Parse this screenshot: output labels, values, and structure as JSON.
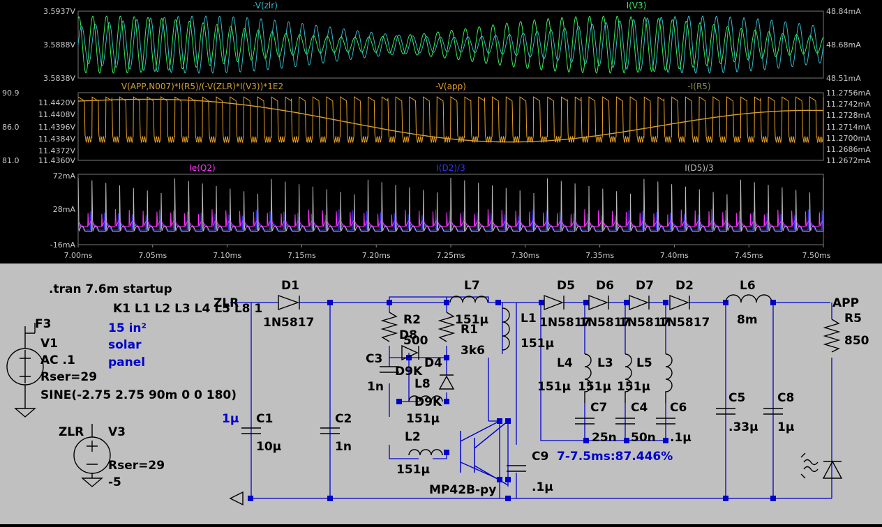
{
  "colors": {
    "zlr": "#33bbcc",
    "iv3": "#33ee55",
    "power": "#d4a030",
    "vapp": "#e8a020",
    "ir5": "#8a8a50",
    "ieq2": "#ff33ff",
    "id2": "#3333ff",
    "id5": "#bbbbbb",
    "wire": "#0000cc",
    "junction": "#0000cc",
    "blue_text": "#0000cc"
  },
  "chart_data": [
    {
      "type": "line",
      "series": [
        {
          "name": "-V(zlr)",
          "color": "#33bbcc",
          "axis": "left",
          "min": 3.5838,
          "max": 3.5937,
          "cycles": 54
        },
        {
          "name": "I(V3)",
          "color": "#33ee55",
          "axis": "right",
          "min": 48.51,
          "max": 48.84,
          "cycles": 54
        }
      ],
      "left_ticks": [
        "3.5937V",
        "3.5888V",
        "3.5838V"
      ],
      "right_ticks": [
        "48.84mA",
        "48.68mA",
        "48.51mA"
      ]
    },
    {
      "type": "line",
      "series": [
        {
          "name": "V(APP,N007)*I(R5)/(-V(ZLR)*I(V3))*1E2",
          "color": "#d4a030",
          "axis": "outer",
          "min": 81.0,
          "max": 90.9
        },
        {
          "name": "-V(app)",
          "color": "#e8a020",
          "axis": "left",
          "min": 11.436,
          "max": 11.442,
          "cycles": 54
        },
        {
          "name": "-I(R5)",
          "color": "#8a8a50",
          "axis": "right",
          "min": 11.2672,
          "max": 11.2756
        }
      ],
      "outer_ticks": [
        "90.9",
        "86.0",
        "81.0"
      ],
      "left_ticks": [
        "11.4420V",
        "11.4408V",
        "11.4396V",
        "11.4384V",
        "11.4372V",
        "11.4360V"
      ],
      "right_ticks": [
        "11.2756mA",
        "11.2742mA",
        "11.2728mA",
        "11.2714mA",
        "11.2700mA",
        "11.2686mA",
        "11.2672mA"
      ]
    },
    {
      "type": "line",
      "series": [
        {
          "name": "Ie(Q2)",
          "color": "#ff33ff",
          "cycles": 54
        },
        {
          "name": "I(D2)/3",
          "color": "#3333ff",
          "cycles": 54
        },
        {
          "name": "I(D5)/3",
          "color": "#bbbbbb",
          "cycles": 54
        }
      ],
      "left_ticks": [
        "72mA",
        "28mA",
        "-16mA"
      ],
      "x_ticks": [
        "7.00ms",
        "7.05ms",
        "7.10ms",
        "7.15ms",
        "7.20ms",
        "7.25ms",
        "7.30ms",
        "7.35ms",
        "7.40ms",
        "7.45ms",
        "7.50ms"
      ],
      "x_range": [
        7.0,
        7.5
      ],
      "x_unit": "ms"
    }
  ],
  "schematic": {
    "directives": {
      "tran": ".tran 7.6m startup",
      "coupling": "K1 L1 L2 L3 L4 L5 L8 1",
      "panel_line1": "15 in²",
      "panel_line2": "solar",
      "panel_line3": "panel",
      "efficiency": "7-7.5ms:87.446%",
      "c1_blue": "1µ"
    },
    "sources": {
      "f3": "F3",
      "v1_name": "V1",
      "v1_ac": "AC .1",
      "v1_rser": "Rser=29",
      "v1_sine": "SINE(-2.75 2.75 90m 0 0 180)",
      "zlr_left": "ZLR",
      "v3_name": "V3",
      "v3_rser": "Rser=29",
      "v3_val": "-5"
    },
    "nets": {
      "zlr": "ZLR",
      "app": "APP"
    },
    "parts": {
      "d1": "D1",
      "d1_val": "1N5817",
      "c1": "C1",
      "c1_val": "10µ",
      "c2": "C2",
      "c2_val": "1n",
      "r2": "R2",
      "r2_val": "500",
      "d8": "D8",
      "d8_val": "D9K",
      "c3": "C3",
      "c3_val": "1n",
      "d4": "D4",
      "d4_val": "D9K",
      "l8": "L8",
      "l8_val": "151µ",
      "l2": "L2",
      "l2_val": "151µ",
      "l7": "L7",
      "l7_val": "151µ",
      "r1": "R1",
      "r1_val": "3k6",
      "l1": "L1",
      "l1_val": "151µ",
      "q2_val": "MP42B-py",
      "c9": "C9",
      "c9_val": ".1µ",
      "d5": "D5",
      "d6": "D6",
      "d7": "D7",
      "d2": "D2",
      "d5_val": "1N5817",
      "d6_val": "1N5817",
      "d7_val": "1N5817",
      "d2_val": "1N5817",
      "l4": "L4",
      "l3": "L3",
      "l5": "L5",
      "l4_val": "151µ",
      "l3_val": "151µ",
      "l5_val": "151µ",
      "c7": "C7",
      "c4": "C4",
      "c6": "C6",
      "c7_val": "25n",
      "c4_val": "50n",
      "c6_val": ".1µ",
      "l6": "L6",
      "l6_val": "8m",
      "c5": "C5",
      "c5_val": ".33µ",
      "c8": "C8",
      "c8_val": "1µ",
      "r5": "R5",
      "r5_val": "850"
    }
  }
}
